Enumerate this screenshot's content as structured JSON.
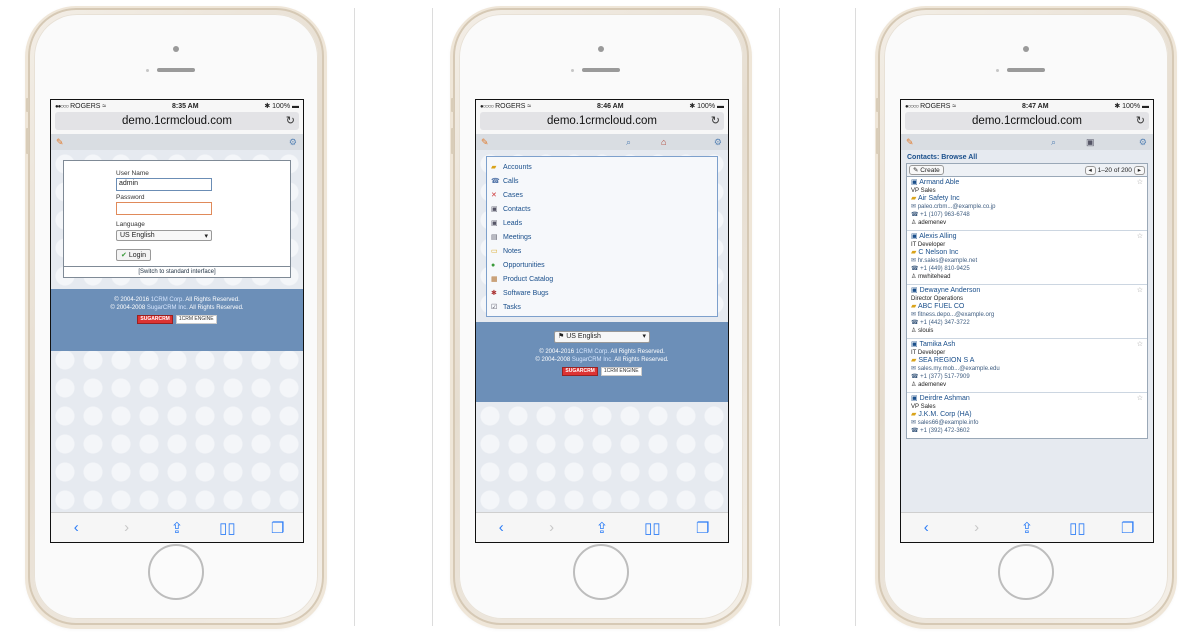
{
  "status": {
    "carrier": "ROGERS",
    "battery": "100%"
  },
  "url": "demo.1crmcloud.com",
  "screens": {
    "login": {
      "time": "8:35 AM",
      "username_label": "User Name",
      "username_value": "admin",
      "password_label": "Password",
      "language_label": "Language",
      "language_value": "US English",
      "login_button": "Login",
      "switch_link": "[Switch to standard interface]"
    },
    "menu": {
      "time": "8:46 AM",
      "items": [
        "Accounts",
        "Calls",
        "Cases",
        "Contacts",
        "Leads",
        "Meetings",
        "Notes",
        "Opportunities",
        "Product Catalog",
        "Software Bugs",
        "Tasks"
      ],
      "language_value": "US English"
    },
    "contacts": {
      "time": "8:47 AM",
      "title": "Contacts: Browse All",
      "create_button": "Create",
      "pager": "1–20 of 200",
      "rows": [
        {
          "name": "Armand Able",
          "title": "VP Sales",
          "account": "Air Safety Inc",
          "email": "paleo.crbm...@example.co.jp",
          "phone": "+1 (107) 963-6748",
          "user": "ademenev"
        },
        {
          "name": "Alexis Alling",
          "title": "IT Developer",
          "account": "C Nelson Inc",
          "email": "hr.sales@example.net",
          "phone": "+1 (449) 810-9425",
          "user": "mwhitehead"
        },
        {
          "name": "Dewayne Anderson",
          "title": "Director Operations",
          "account": "ABC FUEL CO",
          "email": "fitness.depo...@example.org",
          "phone": "+1 (442) 347-3722",
          "user": "slouis"
        },
        {
          "name": "Tamika Ash",
          "title": "IT Developer",
          "account": "SEA REGION S A",
          "email": "sales.my.mob...@example.edu",
          "phone": "+1 (377) 517-7909",
          "user": "ademenev"
        },
        {
          "name": "Deirdre Ashman",
          "title": "VP Sales",
          "account": "J.K.M. Corp (HA)",
          "email": "sales66@example.info",
          "phone": "+1 (392) 472-3602",
          "user": ""
        }
      ]
    }
  },
  "footer": {
    "line1_prefix": "© 2004-2016",
    "line1_link": "1CRM Corp.",
    "line1_suffix": "All Rights Reserved.",
    "line2_prefix": "© 2004-2008",
    "line2_link": "SugarCRM Inc.",
    "line2_suffix": "All Rights Reserved.",
    "badge_sugar": "SUGARCRM",
    "badge_engine": "1CRM ENGINE"
  },
  "colors": {
    "link": "#1a4f8b",
    "footer_bg": "#6c8fb8",
    "ios_blue": "#2d7df6"
  }
}
